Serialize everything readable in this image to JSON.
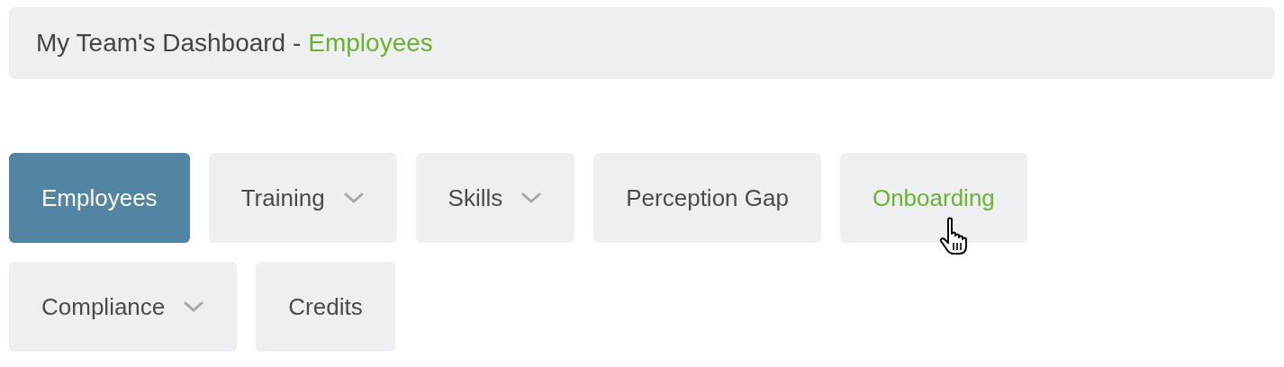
{
  "header": {
    "title": "My Team's Dashboard -",
    "section": "Employees"
  },
  "tab_rows": [
    [
      {
        "label": "Employees",
        "selected": true,
        "hovered": false,
        "has_menu": false
      },
      {
        "label": "Training",
        "selected": false,
        "hovered": false,
        "has_menu": true
      },
      {
        "label": "Skills",
        "selected": false,
        "hovered": false,
        "has_menu": true
      },
      {
        "label": "Perception Gap",
        "selected": false,
        "hovered": false,
        "has_menu": false
      },
      {
        "label": "Onboarding",
        "selected": false,
        "hovered": true,
        "has_menu": false
      }
    ],
    [
      {
        "label": "Compliance",
        "selected": false,
        "hovered": false,
        "has_menu": true
      },
      {
        "label": "Credits",
        "selected": false,
        "hovered": false,
        "has_menu": false
      }
    ]
  ]
}
